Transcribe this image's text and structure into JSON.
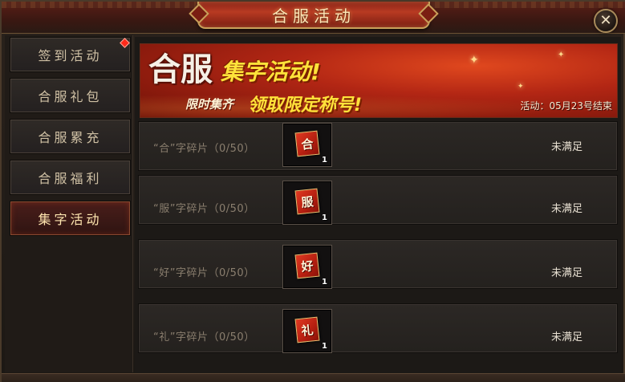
{
  "window": {
    "title": "合服活动",
    "close_symbol": "✕"
  },
  "sidebar": {
    "items": [
      {
        "label": "签到活动",
        "has_notification": true,
        "active": false
      },
      {
        "label": "合服礼包",
        "has_notification": false,
        "active": false
      },
      {
        "label": "合服累充",
        "has_notification": false,
        "active": false
      },
      {
        "label": "合服福利",
        "has_notification": false,
        "active": false
      },
      {
        "label": "集字活动",
        "has_notification": false,
        "active": true
      }
    ]
  },
  "banner": {
    "title_main": "合服",
    "title_sub": "集字活动!",
    "line2_prefix": "限时集齐",
    "line2_main": "领取限定称号!",
    "status": "活动：05月23号结束"
  },
  "rows": [
    {
      "label": "“合”字碎片（0/50）",
      "card_char": "合",
      "count": "1",
      "status": "未满足"
    },
    {
      "label": "“服”字碎片（0/50）",
      "card_char": "服",
      "count": "1",
      "status": "未满足"
    },
    {
      "label": "“好”字碎片（0/50）",
      "card_char": "好",
      "count": "1",
      "status": "未满足"
    },
    {
      "label": "“礼”字碎片（0/50）",
      "card_char": "礼",
      "count": "1",
      "status": "未满足"
    }
  ],
  "colors": {
    "accent_red": "#b22614",
    "gold": "#c9a05a",
    "highlight_yellow": "#ffe23a"
  },
  "icons": {
    "close": "close-icon",
    "notification": "notification-dot-icon",
    "sparkle": "sparkle-icon"
  }
}
